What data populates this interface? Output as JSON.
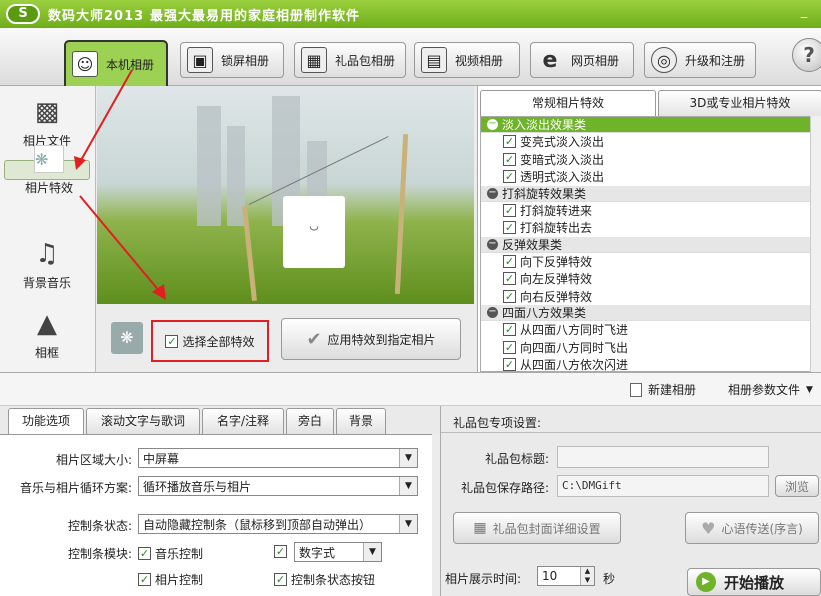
{
  "titlebar": {
    "logo": "S",
    "app_title": "数码大师2013",
    "slogan": "最强大最易用的家庭相册制作软件",
    "min_icon": "_"
  },
  "main_tabs": [
    {
      "label": "本机相册",
      "icon": "user-photo-icon"
    },
    {
      "label": "锁屏相册",
      "icon": "monitor-icon"
    },
    {
      "label": "礼品包相册",
      "icon": "gift-icon"
    },
    {
      "label": "视频相册",
      "icon": "film-icon"
    },
    {
      "label": "网页相册",
      "icon": "ie-icon"
    },
    {
      "label": "升级和注册",
      "icon": "globe-icon"
    }
  ],
  "help_label": "?",
  "left_nav": [
    {
      "label": "相片文件",
      "icon": "camera-icon"
    },
    {
      "label": "相片特效",
      "icon": "effects-icon"
    },
    {
      "label": "背景音乐",
      "icon": "music-icon"
    },
    {
      "label": "相框",
      "icon": "frame-icon"
    }
  ],
  "controls": {
    "select_all": "选择全部特效",
    "apply": "应用特效到指定相片"
  },
  "fx_tabs": [
    "常规相片特效",
    "3D或专业相片特效"
  ],
  "fx_groups": [
    {
      "name": "淡入淡出效果类",
      "items": [
        "变亮式淡入淡出",
        "变暗式淡入淡出",
        "透明式淡入淡出"
      ]
    },
    {
      "name": "打斜旋转效果类",
      "items": [
        "打斜旋转进来",
        "打斜旋转出去"
      ]
    },
    {
      "name": "反弹效果类",
      "items": [
        "向下反弹特效",
        "向左反弹特效",
        "向右反弹特效"
      ]
    },
    {
      "name": "四面八方效果类",
      "items": [
        "从四面八方同时飞进",
        "向四面八方同时飞出",
        "从四面八方依次闪进"
      ]
    }
  ],
  "toolbar2": {
    "new_album": "新建相册",
    "album_params": "相册参数文件"
  },
  "lower_tabs": [
    "功能选项",
    "滚动文字与歌词",
    "名字/注释",
    "旁白",
    "背景"
  ],
  "options": {
    "area_label": "相片区域大小:",
    "area_value": "中屏幕",
    "loop_label": "音乐与相片循环方案:",
    "loop_value": "循环播放音乐与相片",
    "ctrl_state_label": "控制条状态:",
    "ctrl_state_value": "自动隐藏控制条（鼠标移到顶部自动弹出）",
    "ctrl_module_label": "控制条模块:",
    "music_ctrl": "音乐控制",
    "digital_label": "数字式",
    "photo_ctrl": "相片控制",
    "state_btn": "控制条状态按钮"
  },
  "gift": {
    "header": "礼品包专项设置:",
    "title_label": "礼品包标题:",
    "title_value": "",
    "path_label": "礼品包保存路径:",
    "path_value": "C:\\DMGift",
    "browse": "浏览",
    "cover_btn": "礼品包封面详细设置",
    "heart_btn": "心语传送(序言)",
    "time_label": "相片展示时间:",
    "time_value": "10",
    "time_unit": "秒",
    "start_btn": "开始播放"
  }
}
